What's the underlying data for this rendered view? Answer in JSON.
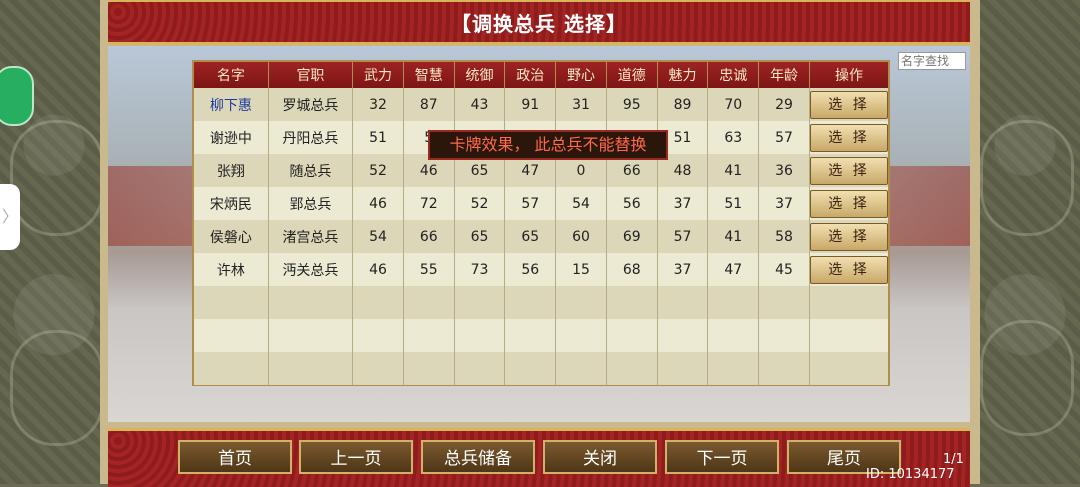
{
  "title": "【调换总兵 选择】",
  "search": {
    "placeholder": "名字查找"
  },
  "table": {
    "headers": [
      "名字",
      "官职",
      "武力",
      "智慧",
      "统御",
      "政治",
      "野心",
      "道德",
      "魅力",
      "忠诚",
      "年龄",
      "操作"
    ],
    "rows": [
      {
        "name": "柳下惠",
        "office": "罗城总兵",
        "wuli": "32",
        "zhihui": "87",
        "tongyu": "43",
        "zhengzhi": "91",
        "yexin": "31",
        "daode": "95",
        "meili": "89",
        "zhongcheng": "70",
        "nianling": "29",
        "action": "选 择"
      },
      {
        "name": "谢逊中",
        "office": "丹阳总兵",
        "wuli": "51",
        "zhihui": "5",
        "tongyu": "",
        "zhengzhi": "",
        "yexin": "",
        "daode": "",
        "meili": "51",
        "zhongcheng": "63",
        "nianling": "57",
        "action": "选 择"
      },
      {
        "name": "张翔",
        "office": "随总兵",
        "wuli": "52",
        "zhihui": "46",
        "tongyu": "65",
        "zhengzhi": "47",
        "yexin": "0",
        "daode": "66",
        "meili": "48",
        "zhongcheng": "41",
        "nianling": "36",
        "action": "选 择"
      },
      {
        "name": "宋炳民",
        "office": "郢总兵",
        "wuli": "46",
        "zhihui": "72",
        "tongyu": "52",
        "zhengzhi": "57",
        "yexin": "54",
        "daode": "56",
        "meili": "37",
        "zhongcheng": "51",
        "nianling": "37",
        "action": "选 择"
      },
      {
        "name": "侯磐心",
        "office": "渚宫总兵",
        "wuli": "54",
        "zhihui": "66",
        "tongyu": "65",
        "zhengzhi": "65",
        "yexin": "60",
        "daode": "69",
        "meili": "57",
        "zhongcheng": "41",
        "nianling": "58",
        "action": "选 择"
      },
      {
        "name": "许林",
        "office": "沔关总兵",
        "wuli": "46",
        "zhihui": "55",
        "tongyu": "73",
        "zhengzhi": "56",
        "yexin": "15",
        "daode": "68",
        "meili": "37",
        "zhongcheng": "47",
        "nianling": "45",
        "action": "选 择"
      }
    ]
  },
  "toast": "卡牌效果， 此总兵不能替换",
  "nav": {
    "first": "首页",
    "prev": "上一页",
    "reserve": "总兵储备",
    "close": "关闭",
    "next": "下一页",
    "last": "尾页"
  },
  "page": "1/1",
  "id_text": "ID: 10134177",
  "side_tab": "〉",
  "colors": {
    "title_red": "#a42424",
    "gold": "#d8b45a",
    "header_text": "#f7e9c2",
    "toast_text": "#ff6a4a"
  }
}
